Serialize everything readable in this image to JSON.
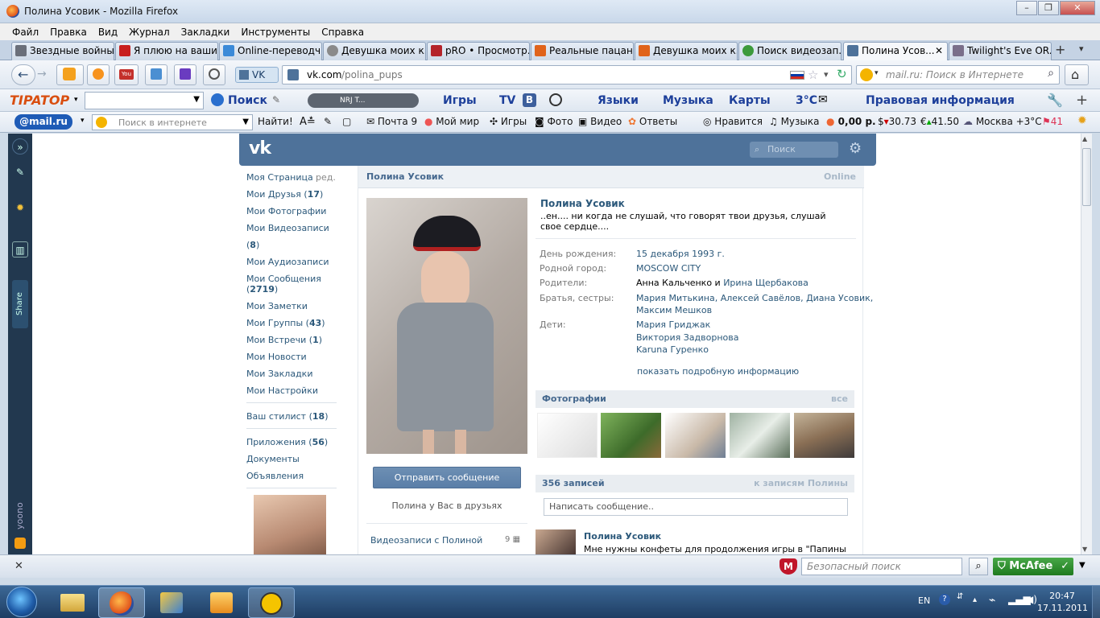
{
  "window": {
    "title": "Полина Усовик - Mozilla Firefox"
  },
  "menu": [
    "Файл",
    "Правка",
    "Вид",
    "Журнал",
    "Закладки",
    "Инструменты",
    "Справка"
  ],
  "tabs": [
    {
      "label": "Звездные войны...",
      "color": "#6a6f7a"
    },
    {
      "label": "Я плюю на ваши...",
      "color": "#c81f1f"
    },
    {
      "label": "Online-переводч...",
      "color": "#3b8ad8"
    },
    {
      "label": "Девушка моих к...",
      "color": "#8a8a8a"
    },
    {
      "label": "pRO • Просмотр...",
      "color": "#b4232a"
    },
    {
      "label": "Реальные пацан...",
      "color": "#e0631b"
    },
    {
      "label": "Девушка моих к...",
      "color": "#e0631b"
    },
    {
      "label": "Поиск видеозап...",
      "color": "#3d9a3b"
    },
    {
      "label": "Полина Усов...",
      "color": "#4e729a"
    },
    {
      "label": "Twilight's Eve OR...",
      "color": "#7a6f8a"
    }
  ],
  "nav": {
    "identity": "VK",
    "url_host": "vk.com",
    "url_path": "/polina_pups",
    "search_placeholder": "mail.ru: Поиск в Интернете"
  },
  "toolbar1": {
    "brand": "TIPATOP",
    "search": "Поиск",
    "player": "NRJ T...",
    "games": "Игры",
    "tv": "TV",
    "languages": "Языки",
    "music": "Музыка",
    "maps": "Карты",
    "temp": "3°C",
    "legal": "Правовая информация"
  },
  "toolbar2": {
    "brand": "@mail.ru",
    "search_placeholder": "Поиск в интернете",
    "find": "Найти!",
    "mail": "Почта 9",
    "myworld": "Мой мир",
    "games": "Игры",
    "photo": "Фото",
    "video": "Видео",
    "answers": "Ответы",
    "like": "Нравится",
    "music": "Музыка",
    "money": "0,00 р.",
    "usd": "30.73",
    "eur": "41.50",
    "weather": "Москва +3°C",
    "count": "41"
  },
  "vk": {
    "search_placeholder": "Поиск",
    "left_nav": [
      {
        "label": "Мои Друзья",
        "count": "17"
      },
      {
        "label": "Мои Фотографии",
        "count": ""
      },
      {
        "label": "Мои Видеозаписи",
        "count": "8"
      },
      {
        "label": "Мои Аудиозаписи",
        "count": ""
      },
      {
        "label": "Мои Сообщения",
        "count": "2719"
      },
      {
        "label": "Мои Заметки",
        "count": ""
      },
      {
        "label": "Мои Группы",
        "count": "43"
      },
      {
        "label": "Мои Встречи",
        "count": "1"
      },
      {
        "label": "Мои Новости",
        "count": ""
      },
      {
        "label": "Мои Закладки",
        "count": ""
      },
      {
        "label": "Мои Настройки",
        "count": ""
      }
    ],
    "my_page": "Моя Страница",
    "edit": "ред.",
    "stylist": {
      "label": "Ваш стилист",
      "count": "18"
    },
    "apps": {
      "label": "Приложения",
      "count": "56"
    },
    "docs": "Документы",
    "ads": "Объявления",
    "header_name": "Полина Усовик",
    "online": "Online",
    "name": "Полина Усовик",
    "status": "..ен.... ни когда не слушай, что говорят твои друзья, слушай свое сердце....",
    "info": {
      "birthday_label": "День рождения:",
      "birthday": "15 декабря 1993 г.",
      "city_label": "Родной город:",
      "city": "MOSCOW CITY",
      "parents_label": "Родители:",
      "parent1": "Анна Кальченко",
      "and": "и",
      "parent2": "Ирина Щербакова",
      "siblings_label": "Братья, сестры:",
      "siblings1": "Мария Митькина, Алексей Савёлов, Диана Усовик,",
      "siblings2": "Максим Мешков",
      "children_label": "Дети:",
      "child1": "Мария Гриджак",
      "child2": "Виктория Задворнова",
      "child3": "Karuna Гуренко",
      "more": "показать подробную информацию"
    },
    "photos_title": "Фотографии",
    "photos_all": "все",
    "send_message": "Отправить сообщение",
    "friends_note": "Полина у Вас в друзьях",
    "videos_link": "Видеозаписи с Полиной",
    "videos_count": "9",
    "wall_count": "356 записей",
    "wall_link": "к записям Полины",
    "wall_placeholder": "Написать сообщение..",
    "post_author": "Полина Усовик",
    "post_text": "Мне нужны конфеты для продолжения игры в \"Папины"
  },
  "statusbar": {
    "safe_search": "Безопасный поиск",
    "mcafee": "McAfee"
  },
  "taskbar": {
    "lang": "EN",
    "time": "20:47",
    "date": "17.11.2011"
  }
}
